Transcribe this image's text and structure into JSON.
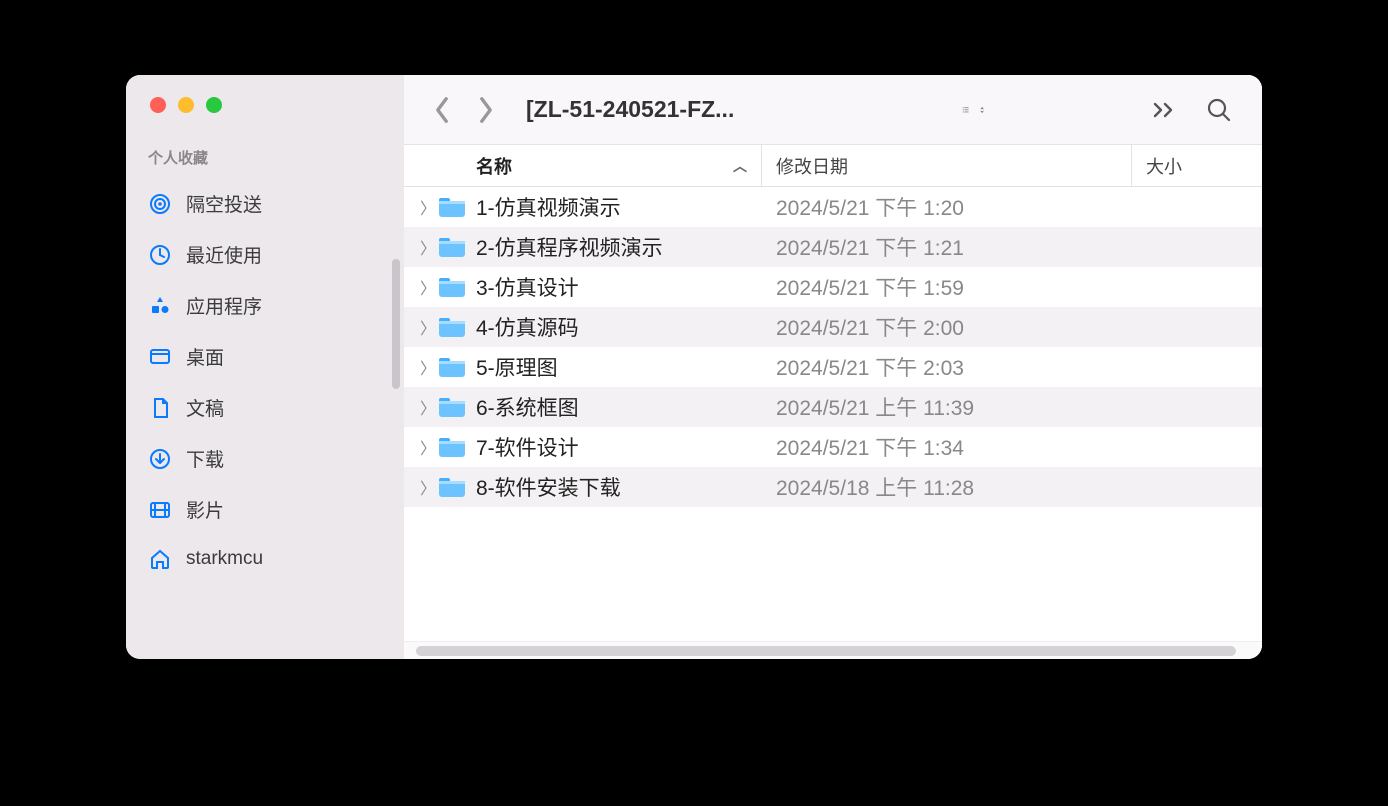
{
  "window_title": "[ZL-51-240521-FZ...",
  "sidebar": {
    "section_label": "个人收藏",
    "items": [
      {
        "icon": "airdrop",
        "label": "隔空投送"
      },
      {
        "icon": "clock",
        "label": "最近使用"
      },
      {
        "icon": "apps",
        "label": "应用程序"
      },
      {
        "icon": "desktop",
        "label": "桌面"
      },
      {
        "icon": "document",
        "label": "文稿"
      },
      {
        "icon": "download",
        "label": "下载"
      },
      {
        "icon": "movie",
        "label": "影片"
      },
      {
        "icon": "home",
        "label": "starkmcu"
      }
    ]
  },
  "columns": {
    "name": "名称",
    "date": "修改日期",
    "size": "大小"
  },
  "rows": [
    {
      "name": "1-仿真视频演示",
      "date": "2024/5/21 下午 1:20",
      "size": ""
    },
    {
      "name": "2-仿真程序视频演示",
      "date": "2024/5/21 下午 1:21",
      "size": ""
    },
    {
      "name": "3-仿真设计",
      "date": "2024/5/21 下午 1:59",
      "size": ""
    },
    {
      "name": "4-仿真源码",
      "date": "2024/5/21 下午 2:00",
      "size": ""
    },
    {
      "name": "5-原理图",
      "date": "2024/5/21 下午 2:03",
      "size": ""
    },
    {
      "name": "6-系统框图",
      "date": "2024/5/21 上午 11:39",
      "size": ""
    },
    {
      "name": "7-软件设计",
      "date": "2024/5/21 下午 1:34",
      "size": ""
    },
    {
      "name": "8-软件安装下载",
      "date": "2024/5/18 上午 11:28",
      "size": ""
    }
  ]
}
